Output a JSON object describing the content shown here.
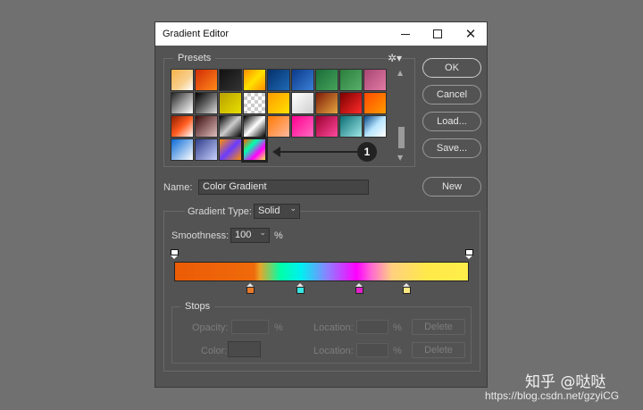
{
  "window": {
    "title": "Gradient Editor",
    "close_glyph": "✕"
  },
  "presets": {
    "label": "Presets",
    "gear_glyph": "✲▾",
    "swatches": [
      {
        "bg": "linear-gradient(135deg,#f6b24a,#f8d090 60%,#ffffff)"
      },
      {
        "bg": "linear-gradient(135deg,#d22c06,#ff8a1a)"
      },
      {
        "bg": "linear-gradient(135deg,#111111,#333333)"
      },
      {
        "bg": "linear-gradient(135deg,#ff8c00,#ffe200,#ff8c00)"
      },
      {
        "bg": "linear-gradient(135deg,#06306a,#1e6ab8)"
      },
      {
        "bg": "linear-gradient(135deg,#0a3a8a,#3b7fd6)"
      },
      {
        "bg": "linear-gradient(135deg,#1b6e3a,#45a35a)"
      },
      {
        "bg": "linear-gradient(135deg,#2c7d3c,#58b06a)"
      },
      {
        "bg": "linear-gradient(135deg,#a84674,#e27ba4)"
      },
      {
        "bg": "linear-gradient(135deg,#222,#999,#fff)"
      },
      {
        "bg": "linear-gradient(135deg,#000,#666,#ddd)"
      },
      {
        "bg": "linear-gradient(135deg,#b8a000,#e8e000)"
      },
      {
        "bg": "repeating-conic-gradient(#ccc 0% 25%,#fff 0% 50%) 0 0/8px 8px"
      },
      {
        "bg": "linear-gradient(135deg,#ff9a00,#ffe200)"
      },
      {
        "bg": "linear-gradient(135deg,#ffffff,#cfcfcf)"
      },
      {
        "bg": "linear-gradient(135deg,#7e1a08,#e6a640)"
      },
      {
        "bg": "linear-gradient(135deg,#7c0000,#ff2a2a)"
      },
      {
        "bg": "linear-gradient(135deg,#ff4a00,#ff9c00)"
      },
      {
        "bg": "linear-gradient(135deg,#8a1d00,#ff5a1e,#fff)"
      },
      {
        "bg": "linear-gradient(135deg,#3d0d0d,#e0bdbd)"
      },
      {
        "bg": "linear-gradient(135deg,#000,#ccc,#000)"
      },
      {
        "bg": "linear-gradient(135deg,#000,#fff,#000)"
      },
      {
        "bg": "linear-gradient(135deg,#ff7a00,#ffb8a0)"
      },
      {
        "bg": "linear-gradient(135deg,#ff0090,#ff6ac0)"
      },
      {
        "bg": "linear-gradient(135deg,#9e0030,#ff4a9e)"
      },
      {
        "bg": "linear-gradient(135deg,#0a6e74,#9ee6e6)"
      },
      {
        "bg": "linear-gradient(135deg,#0a4a8a,#b8e6ff,#fff)"
      },
      {
        "bg": "linear-gradient(135deg,#0a6ad6,#ffffff)"
      },
      {
        "bg": "linear-gradient(135deg,#2f3e8a,#c8d0ff)"
      },
      {
        "bg": "linear-gradient(135deg,#ff9000,#6a3cff,#ff9000)"
      },
      {
        "bg": "linear-gradient(135deg,#ff5a00,#00ffb0,#ff00ff,#ffee4a)",
        "selected": true
      }
    ],
    "callout_number": "1"
  },
  "buttons": {
    "ok": "OK",
    "cancel": "Cancel",
    "load": "Load...",
    "save": "Save...",
    "new": "New"
  },
  "name": {
    "label": "Name:",
    "value": "Color Gradient"
  },
  "gradient": {
    "type_label": "Gradient Type:",
    "type_value": "Solid",
    "smoothness_label": "Smoothness:",
    "smoothness_value": "100",
    "smoothness_unit": "%",
    "chevron_glyph": "⌄",
    "color_stops": [
      {
        "color": "#e8782a",
        "position_pct": 26
      },
      {
        "color": "#35e6e2",
        "position_pct": 43
      },
      {
        "color": "#e020c8",
        "position_pct": 63
      },
      {
        "color": "#ffe880",
        "position_pct": 79
      }
    ],
    "opacity_stops": [
      {
        "position_pct": 0
      },
      {
        "position_pct": 100
      }
    ]
  },
  "stops": {
    "label": "Stops",
    "opacity_label": "Opacity:",
    "opacity_unit": "%",
    "color_label": "Color:",
    "location_label": "Location:",
    "location_unit": "%",
    "delete_label": "Delete"
  },
  "watermark": {
    "text": "知乎 @哒哒",
    "url": "https://blog.csdn.net/gzyiCG"
  }
}
